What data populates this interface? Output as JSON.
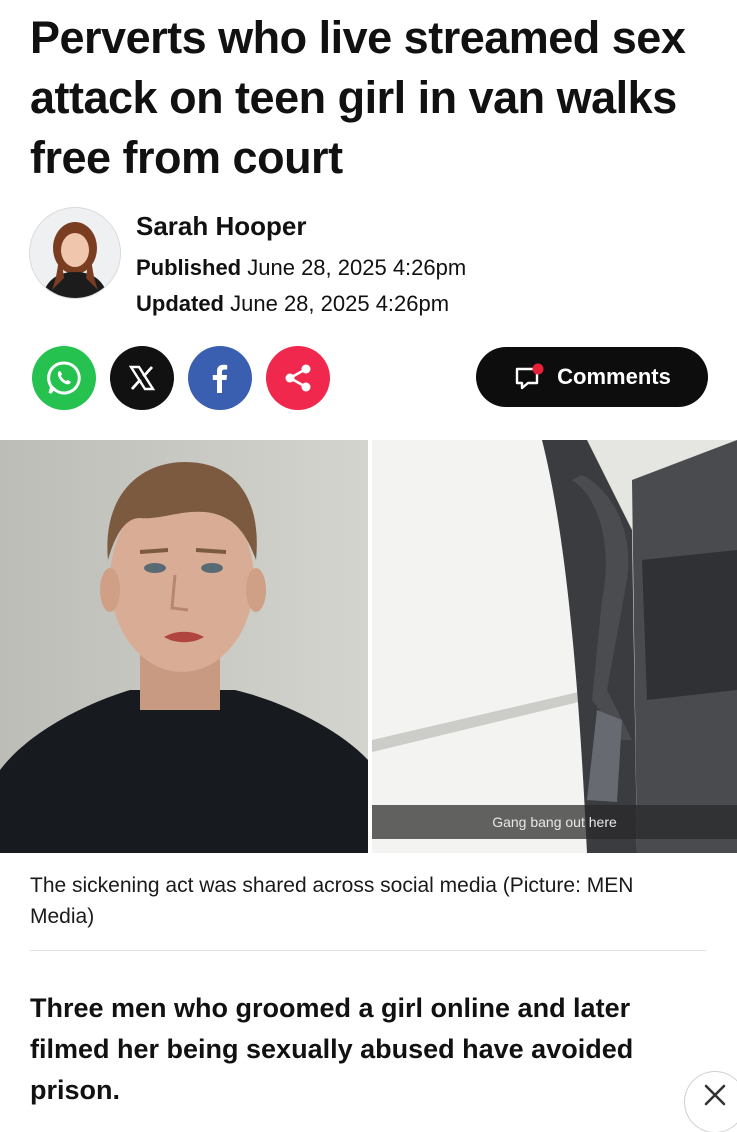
{
  "article": {
    "headline": "Perverts who live streamed sex attack on teen girl in van walks free from court",
    "author": "Sarah Hooper",
    "published_label": "Published",
    "published_date": "June 28, 2025 4:26pm",
    "updated_label": "Updated",
    "updated_date": "June 28, 2025 4:26pm",
    "image_overlay_text": "Gang bang out here",
    "caption": "The sickening act was shared across social media (Picture: MEN Media)",
    "lede": "Three men who groomed a girl online and later filmed her being sexually abused have avoided prison."
  },
  "share": {
    "icons": [
      "whatsapp-icon",
      "x-icon",
      "facebook-icon",
      "share-icon"
    ],
    "colors": {
      "whatsapp": "#25c24f",
      "x": "#111111",
      "facebook": "#3b5fb0",
      "share": "#f0284d"
    }
  },
  "comments": {
    "label": "Comments",
    "icon": "comment-bubble-icon",
    "accent": "#e8213b"
  },
  "overlay": {
    "close_icon": "close-icon"
  }
}
